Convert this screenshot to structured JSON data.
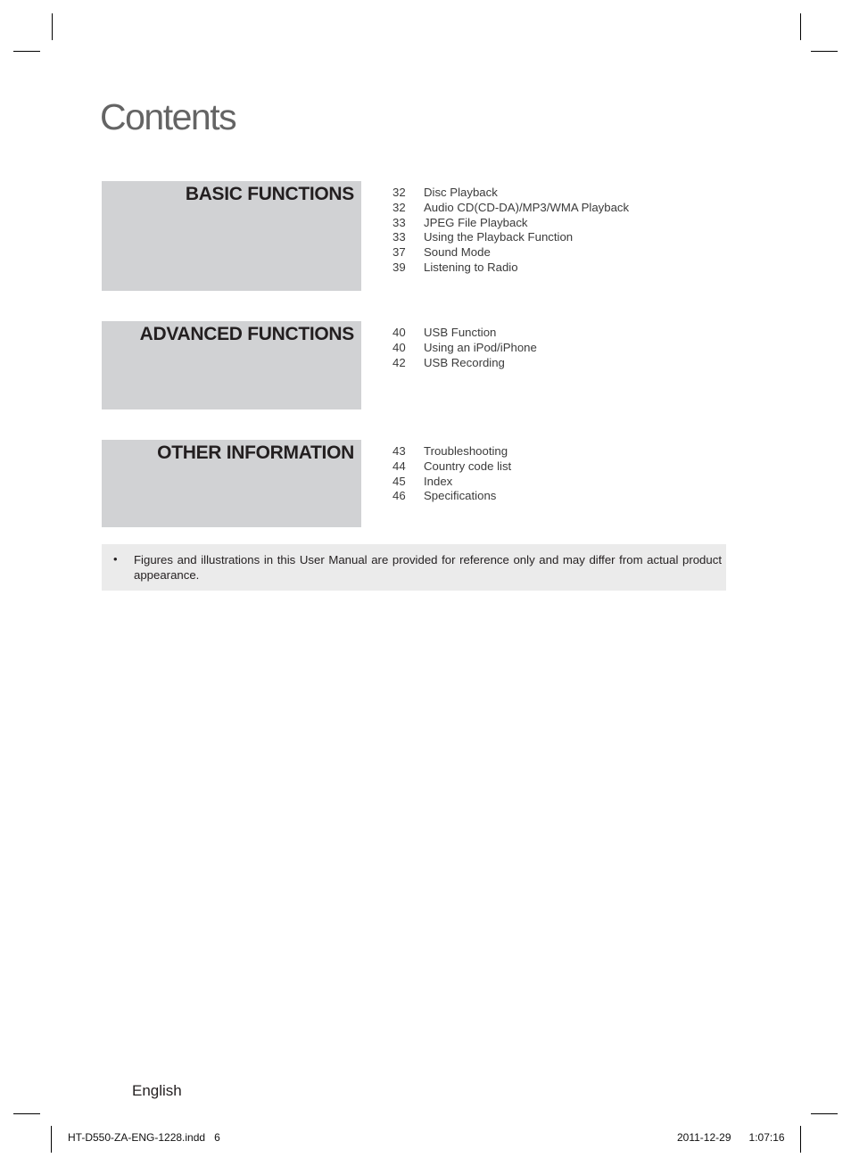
{
  "page": {
    "title": "Contents"
  },
  "sections": [
    {
      "title": "BASIC FUNCTIONS",
      "items": [
        {
          "page": "32",
          "label": "Disc Playback"
        },
        {
          "page": "32",
          "label": "Audio CD(CD-DA)/MP3/WMA Playback"
        },
        {
          "page": "33",
          "label": "JPEG File Playback"
        },
        {
          "page": "33",
          "label": "Using the Playback Function"
        },
        {
          "page": "37",
          "label": "Sound Mode"
        },
        {
          "page": "39",
          "label": "Listening to Radio"
        }
      ]
    },
    {
      "title": "ADVANCED FUNCTIONS",
      "items": [
        {
          "page": "40",
          "label": "USB Function"
        },
        {
          "page": "40",
          "label": "Using an iPod/iPhone"
        },
        {
          "page": "42",
          "label": "USB Recording"
        }
      ]
    },
    {
      "title": "OTHER INFORMATION",
      "items": [
        {
          "page": "43",
          "label": "Troubleshooting"
        },
        {
          "page": "44",
          "label": "Country code list"
        },
        {
          "page": "45",
          "label": "Index"
        },
        {
          "page": "46",
          "label": "Specifications"
        }
      ]
    }
  ],
  "note": {
    "bullet": "•",
    "text": "Figures and illustrations in this User Manual are provided for reference only and may differ from actual product appearance."
  },
  "footer": {
    "language": "English",
    "slug_file": "HT-D550-ZA-ENG-1228.indd",
    "slug_page": "6",
    "slug_date": "2011-12-29",
    "slug_time": "1:07:16"
  },
  "colors": {
    "section_panel": "#d1d2d4",
    "note_background": "#ebebeb",
    "text": "#231f20"
  }
}
